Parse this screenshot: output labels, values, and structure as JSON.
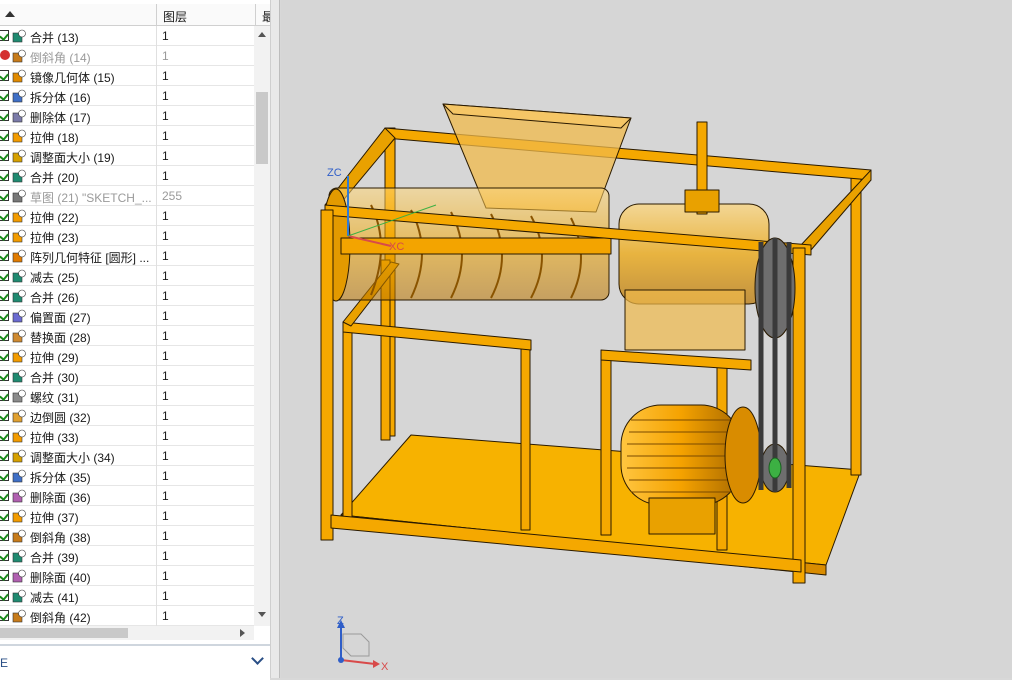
{
  "tree": {
    "columns": {
      "name": "",
      "layer": "图层",
      "extra": "最"
    },
    "rows": [
      {
        "label": "合并 (13)",
        "layer": "1",
        "icon": "unite-icon",
        "dim": false,
        "error": false
      },
      {
        "label": "倒斜角 (14)",
        "layer": "1",
        "icon": "chamfer-icon",
        "dim": true,
        "error": true
      },
      {
        "label": "镜像几何体 (15)",
        "layer": "1",
        "icon": "mirror-body-icon",
        "dim": false,
        "error": false
      },
      {
        "label": "拆分体 (16)",
        "layer": "1",
        "icon": "split-body-icon",
        "dim": false,
        "error": false
      },
      {
        "label": "删除体 (17)",
        "layer": "1",
        "icon": "delete-body-icon",
        "dim": false,
        "error": false
      },
      {
        "label": "拉伸 (18)",
        "layer": "1",
        "icon": "extrude-icon",
        "dim": false,
        "error": false
      },
      {
        "label": "调整面大小 (19)",
        "layer": "1",
        "icon": "resize-face-icon",
        "dim": false,
        "error": false
      },
      {
        "label": "合并 (20)",
        "layer": "1",
        "icon": "unite-icon",
        "dim": false,
        "error": false
      },
      {
        "label": "草图 (21) \"SKETCH_...",
        "layer": "255",
        "icon": "sketch-icon",
        "dim": true,
        "error": false
      },
      {
        "label": "拉伸 (22)",
        "layer": "1",
        "icon": "extrude-icon",
        "dim": false,
        "error": false
      },
      {
        "label": "拉伸 (23)",
        "layer": "1",
        "icon": "extrude-icon",
        "dim": false,
        "error": false
      },
      {
        "label": "阵列几何特征 [圆形] ...",
        "layer": "1",
        "icon": "pattern-icon",
        "dim": false,
        "error": false
      },
      {
        "label": "减去 (25)",
        "layer": "1",
        "icon": "subtract-icon",
        "dim": false,
        "error": false
      },
      {
        "label": "合并 (26)",
        "layer": "1",
        "icon": "unite-icon",
        "dim": false,
        "error": false
      },
      {
        "label": "偏置面 (27)",
        "layer": "1",
        "icon": "offset-face-icon",
        "dim": false,
        "error": false
      },
      {
        "label": "替换面 (28)",
        "layer": "1",
        "icon": "replace-face-icon",
        "dim": false,
        "error": false
      },
      {
        "label": "拉伸 (29)",
        "layer": "1",
        "icon": "extrude-icon",
        "dim": false,
        "error": false
      },
      {
        "label": "合并 (30)",
        "layer": "1",
        "icon": "unite-icon",
        "dim": false,
        "error": false
      },
      {
        "label": "螺纹 (31)",
        "layer": "1",
        "icon": "thread-icon",
        "dim": false,
        "error": false
      },
      {
        "label": "边倒圆 (32)",
        "layer": "1",
        "icon": "edge-blend-icon",
        "dim": false,
        "error": false
      },
      {
        "label": "拉伸 (33)",
        "layer": "1",
        "icon": "extrude-icon",
        "dim": false,
        "error": false
      },
      {
        "label": "调整面大小 (34)",
        "layer": "1",
        "icon": "resize-face-icon",
        "dim": false,
        "error": false
      },
      {
        "label": "拆分体 (35)",
        "layer": "1",
        "icon": "split-body-icon",
        "dim": false,
        "error": false
      },
      {
        "label": "删除面 (36)",
        "layer": "1",
        "icon": "delete-face-icon",
        "dim": false,
        "error": false
      },
      {
        "label": "拉伸 (37)",
        "layer": "1",
        "icon": "extrude-icon",
        "dim": false,
        "error": false
      },
      {
        "label": "倒斜角 (38)",
        "layer": "1",
        "icon": "chamfer-icon",
        "dim": false,
        "error": false
      },
      {
        "label": "合并 (39)",
        "layer": "1",
        "icon": "unite-icon",
        "dim": false,
        "error": false
      },
      {
        "label": "删除面 (40)",
        "layer": "1",
        "icon": "delete-face-icon",
        "dim": false,
        "error": false
      },
      {
        "label": "减去 (41)",
        "layer": "1",
        "icon": "subtract-icon",
        "dim": false,
        "error": false
      },
      {
        "label": "倒斜角 (42)",
        "layer": "1",
        "icon": "chamfer-icon",
        "dim": false,
        "error": false
      }
    ]
  },
  "bottom_panel": {
    "label": "E"
  },
  "viewport": {
    "wcs": {
      "zc": "ZC",
      "xc": "XC"
    },
    "triad": {
      "z": "Z",
      "x": "X"
    }
  },
  "colors": {
    "body": "#f5a800",
    "edge": "#2a1a00",
    "frame_dark": "#c97c00",
    "panel_bg": "#ffffff",
    "viewport_bg": "#d6d6d6"
  }
}
